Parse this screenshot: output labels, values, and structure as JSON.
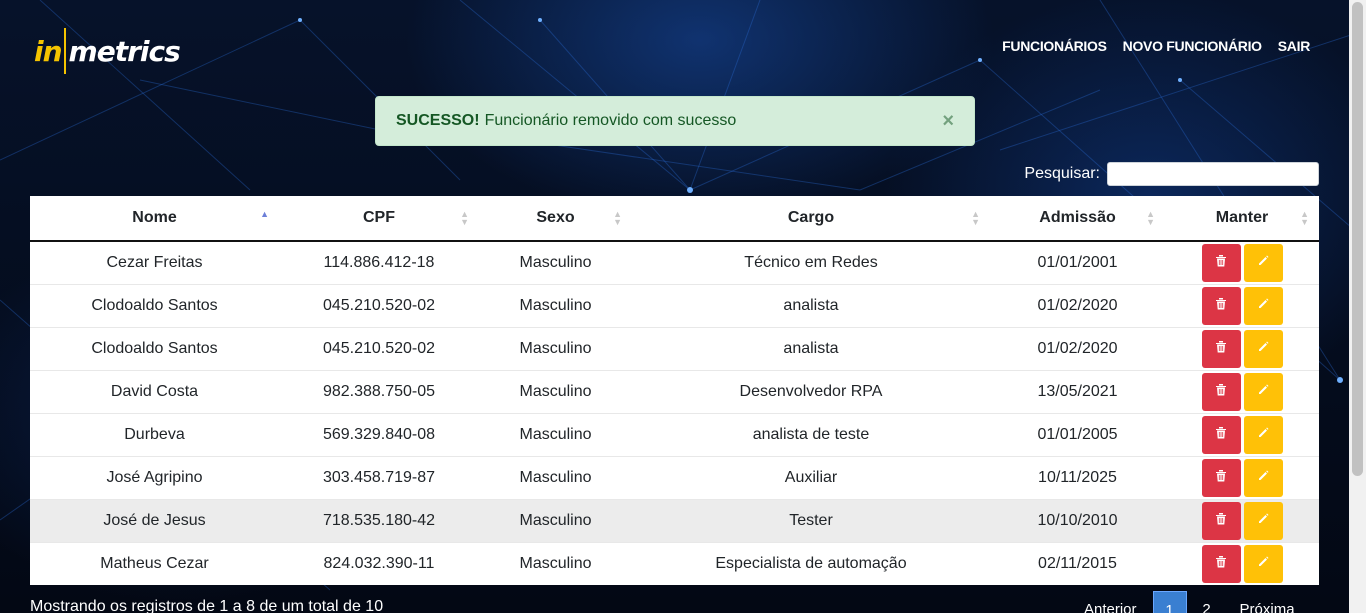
{
  "brand": {
    "part1": "in",
    "part2": "metrics"
  },
  "nav": {
    "items": [
      {
        "label": "FUNCIONÁRIOS"
      },
      {
        "label": "NOVO FUNCIONÁRIO"
      },
      {
        "label": "SAIR"
      }
    ]
  },
  "alert": {
    "strong": "SUCESSO!",
    "message": "Funcionário removido com sucesso",
    "close": "×"
  },
  "search": {
    "label": "Pesquisar:",
    "value": ""
  },
  "table": {
    "headers": [
      "Nome",
      "CPF",
      "Sexo",
      "Cargo",
      "Admissão",
      "Manter"
    ],
    "sorted_column": "Nome",
    "sort_direction": "asc",
    "rows": [
      [
        "Cezar Freitas",
        "114.886.412-18",
        "Masculino",
        "Técnico em Redes",
        "01/01/2001"
      ],
      [
        "Clodoaldo Santos",
        "045.210.520-02",
        "Masculino",
        "analista",
        "01/02/2020"
      ],
      [
        "Clodoaldo Santos",
        "045.210.520-02",
        "Masculino",
        "analista",
        "01/02/2020"
      ],
      [
        "David Costa",
        "982.388.750-05",
        "Masculino",
        "Desenvolvedor RPA",
        "13/05/2021"
      ],
      [
        "Durbeva",
        "569.329.840-08",
        "Masculino",
        "analista de teste",
        "01/01/2005"
      ],
      [
        "José Agripino",
        "303.458.719-87",
        "Masculino",
        "Auxiliar",
        "10/11/2025"
      ],
      [
        "José de Jesus",
        "718.535.180-42",
        "Masculino",
        "Tester",
        "10/10/2010"
      ],
      [
        "Matheus Cezar",
        "824.032.390-11",
        "Masculino",
        "Especialista de automação",
        "02/11/2015"
      ]
    ],
    "hovered_row": 6,
    "actions": {
      "delete_icon": "trash-icon",
      "edit_icon": "pencil-icon"
    }
  },
  "footer": {
    "info": "Mostrando os registros de 1 a 8 de um total de 10",
    "pagination": {
      "prev": "Anterior",
      "pages": [
        "1",
        "2"
      ],
      "current": "1",
      "next": "Próxima"
    }
  },
  "colors": {
    "danger": "#dc3545",
    "warning": "#ffc107",
    "success_bg": "#d4edda",
    "success_text": "#155724",
    "brand_yellow": "#f5c400"
  }
}
